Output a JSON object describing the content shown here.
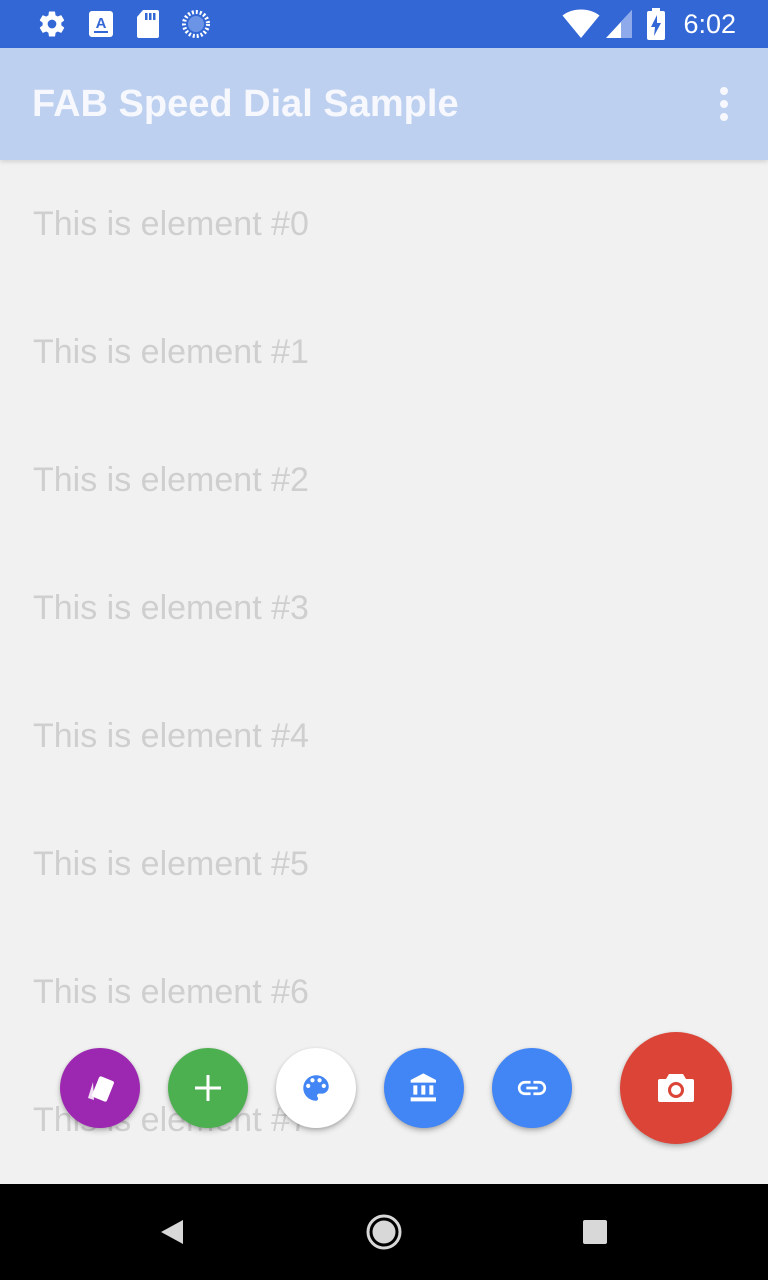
{
  "status_bar": {
    "time": "6:02",
    "icons": [
      "settings-icon",
      "a11y-keyboard-icon",
      "sd-card-icon",
      "sync-progress-icon",
      "wifi-icon",
      "cell-signal-icon",
      "battery-charging-icon"
    ],
    "color": "#3367d6"
  },
  "app_bar": {
    "title": "FAB Speed Dial Sample",
    "menu_icon": "more-vertical-icon",
    "color": "#bdd0f0"
  },
  "list": {
    "items": [
      "This is element #0",
      "This is element #1",
      "This is element #2",
      "This is element #3",
      "This is element #4",
      "This is element #5",
      "This is element #6",
      "This is element #7"
    ]
  },
  "speed_dial": {
    "menu_items": [
      {
        "icon": "cards-icon",
        "color": "#9c27b0"
      },
      {
        "icon": "add-icon",
        "color": "#4caf50"
      },
      {
        "icon": "palette-icon",
        "color": "#ffffff"
      },
      {
        "icon": "bank-icon",
        "color": "#4285f4"
      },
      {
        "icon": "link-icon",
        "color": "#4285f4"
      }
    ],
    "main": {
      "icon": "camera-icon",
      "color": "#db4437"
    }
  },
  "nav_bar": {
    "buttons": [
      "back-icon",
      "home-icon",
      "recents-icon"
    ]
  }
}
